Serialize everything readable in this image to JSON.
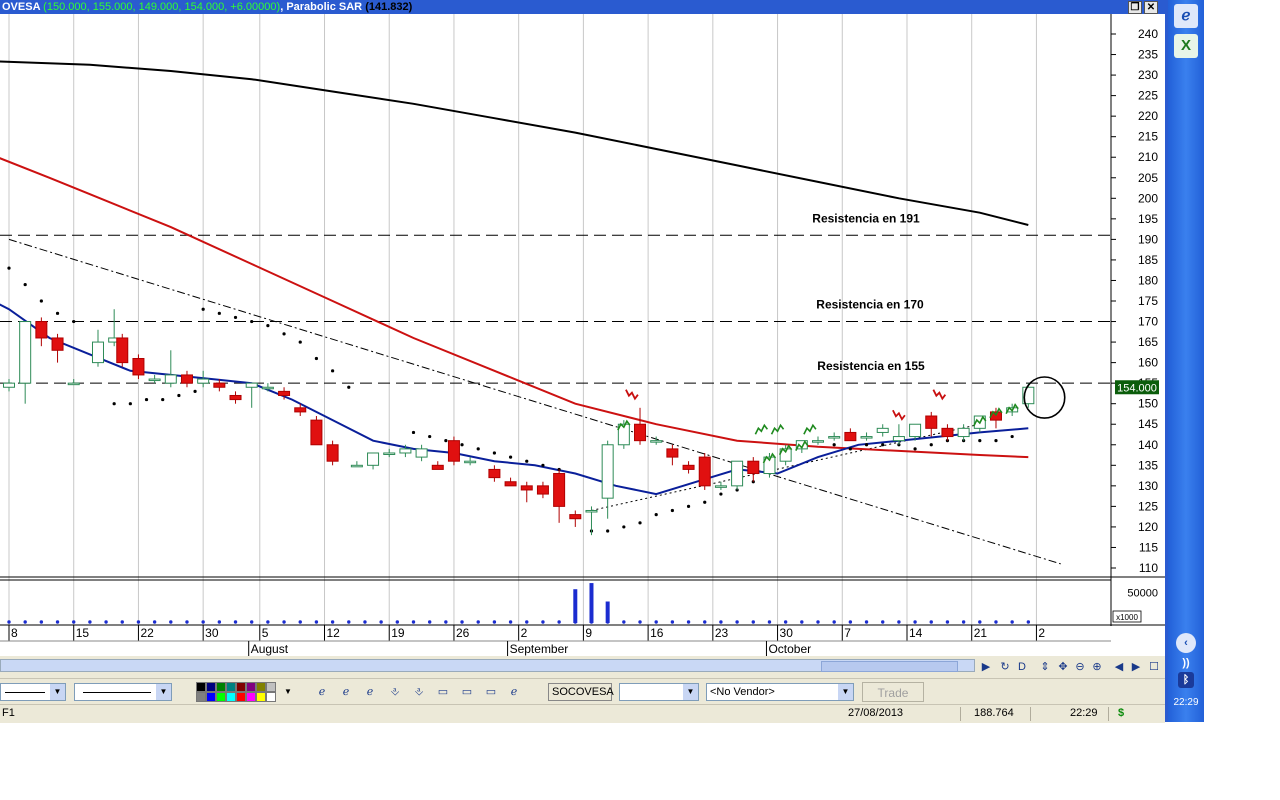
{
  "window": {
    "title_ticker": "OVESA",
    "title_values": "(150.000, 155.000, 149.000, 154.000, +6.00000)",
    "title_indicator": "Parabolic SAR",
    "title_sar_value": "(141.832)",
    "restore_label": "❐",
    "close_label": "✕"
  },
  "taskbar": {
    "clock": "22:29"
  },
  "toolbar": {
    "symbol": "SOCOVESA",
    "vendor": "<No Vendor>",
    "trade_label": "Trade",
    "palette": [
      "#000000",
      "#000080",
      "#008000",
      "#008080",
      "#800000",
      "#800080",
      "#808000",
      "#c0c0c0",
      "#808080",
      "#0000ff",
      "#00ff00",
      "#00ffff",
      "#ff0000",
      "#ff00ff",
      "#ffff00",
      "#ffffff"
    ],
    "nav_labels": [
      "D"
    ]
  },
  "statusbar": {
    "left": "F1",
    "date": "27/08/2013",
    "value": "188.764",
    "time": "22:29",
    "dollar": "$"
  },
  "chart_data": {
    "type": "candlestick",
    "ylim": [
      108,
      243
    ],
    "y_ticks": [
      110,
      115,
      120,
      125,
      130,
      135,
      140,
      145,
      150,
      155,
      160,
      165,
      170,
      175,
      180,
      185,
      190,
      195,
      200,
      205,
      210,
      215,
      220,
      225,
      230,
      235,
      240
    ],
    "x_tick_labels": [
      "8",
      "15",
      "22",
      "30",
      "5",
      "12",
      "19",
      "26",
      "2",
      "9",
      "16",
      "23",
      "30",
      "7",
      "14",
      "21",
      "2"
    ],
    "x_tick_index": [
      0,
      8,
      16,
      24,
      31,
      39,
      47,
      55,
      63,
      71,
      79,
      87,
      95,
      103,
      111,
      119,
      127
    ],
    "month_labels": [
      {
        "label": "August",
        "index": 30
      },
      {
        "label": "September",
        "index": 62
      },
      {
        "label": "October",
        "index": 94
      }
    ],
    "last_price_label": "154.000",
    "volume_axis_label": "50000",
    "volume_unit": "x1000",
    "annotations": [
      {
        "text": "Resistencia en 191",
        "value": 191
      },
      {
        "text": "Resistencia en 170",
        "value": 170
      },
      {
        "text": "Resistencia en 155",
        "value": 155
      }
    ],
    "candles": [
      {
        "i": 0,
        "o": 154,
        "h": 156,
        "l": 153,
        "c": 155
      },
      {
        "i": 2,
        "o": 155,
        "h": 170,
        "l": 150,
        "c": 170
      },
      {
        "i": 4,
        "o": 170,
        "h": 171,
        "l": 164,
        "c": 166
      },
      {
        "i": 6,
        "o": 166,
        "h": 167,
        "l": 160,
        "c": 163
      },
      {
        "i": 8,
        "o": 155,
        "h": 156,
        "l": 155,
        "c": 155
      },
      {
        "i": 11,
        "o": 160,
        "h": 168,
        "l": 159,
        "c": 165
      },
      {
        "i": 13,
        "o": 165,
        "h": 173,
        "l": 164,
        "c": 166
      },
      {
        "i": 14,
        "o": 166,
        "h": 167,
        "l": 159,
        "c": 160
      },
      {
        "i": 16,
        "o": 161,
        "h": 162,
        "l": 156,
        "c": 157
      },
      {
        "i": 18,
        "o": 156,
        "h": 157,
        "l": 155,
        "c": 156
      },
      {
        "i": 20,
        "o": 155,
        "h": 163,
        "l": 154,
        "c": 157
      },
      {
        "i": 22,
        "o": 157,
        "h": 158,
        "l": 154,
        "c": 155
      },
      {
        "i": 24,
        "o": 155,
        "h": 158,
        "l": 154,
        "c": 156
      },
      {
        "i": 26,
        "o": 155,
        "h": 156,
        "l": 153,
        "c": 154
      },
      {
        "i": 28,
        "o": 152,
        "h": 153,
        "l": 150,
        "c": 151
      },
      {
        "i": 30,
        "o": 154,
        "h": 155,
        "l": 149,
        "c": 155
      },
      {
        "i": 32,
        "o": 154,
        "h": 155,
        "l": 153,
        "c": 154
      },
      {
        "i": 34,
        "o": 153,
        "h": 154,
        "l": 151,
        "c": 152
      },
      {
        "i": 36,
        "o": 149,
        "h": 150,
        "l": 147,
        "c": 148
      },
      {
        "i": 38,
        "o": 146,
        "h": 147,
        "l": 140,
        "c": 140
      },
      {
        "i": 40,
        "o": 140,
        "h": 141,
        "l": 135,
        "c": 136
      },
      {
        "i": 43,
        "o": 135,
        "h": 136,
        "l": 135,
        "c": 135
      },
      {
        "i": 45,
        "o": 135,
        "h": 138,
        "l": 134,
        "c": 138
      },
      {
        "i": 47,
        "o": 138,
        "h": 139,
        "l": 137,
        "c": 138
      },
      {
        "i": 49,
        "o": 138,
        "h": 140,
        "l": 137,
        "c": 139
      },
      {
        "i": 51,
        "o": 137,
        "h": 140,
        "l": 136,
        "c": 139
      },
      {
        "i": 53,
        "o": 135,
        "h": 136,
        "l": 134,
        "c": 134
      },
      {
        "i": 55,
        "o": 141,
        "h": 142,
        "l": 135,
        "c": 136
      },
      {
        "i": 57,
        "o": 136,
        "h": 137,
        "l": 135,
        "c": 136
      },
      {
        "i": 60,
        "o": 134,
        "h": 135,
        "l": 131,
        "c": 132
      },
      {
        "i": 62,
        "o": 131,
        "h": 132,
        "l": 130,
        "c": 130
      },
      {
        "i": 64,
        "o": 130,
        "h": 131,
        "l": 126,
        "c": 129
      },
      {
        "i": 66,
        "o": 130,
        "h": 131,
        "l": 127,
        "c": 128
      },
      {
        "i": 68,
        "o": 133,
        "h": 134,
        "l": 121,
        "c": 125
      },
      {
        "i": 70,
        "o": 123,
        "h": 124,
        "l": 120,
        "c": 122
      },
      {
        "i": 72,
        "o": 124,
        "h": 125,
        "l": 118,
        "c": 124
      },
      {
        "i": 74,
        "o": 127,
        "h": 141,
        "l": 122,
        "c": 140
      },
      {
        "i": 76,
        "o": 140,
        "h": 146,
        "l": 139,
        "c": 145
      },
      {
        "i": 78,
        "o": 145,
        "h": 149,
        "l": 140,
        "c": 141
      },
      {
        "i": 80,
        "o": 141,
        "h": 142,
        "l": 140,
        "c": 141
      },
      {
        "i": 82,
        "o": 139,
        "h": 140,
        "l": 135,
        "c": 137
      },
      {
        "i": 84,
        "o": 135,
        "h": 136,
        "l": 133,
        "c": 134
      },
      {
        "i": 86,
        "o": 137,
        "h": 138,
        "l": 129,
        "c": 130
      },
      {
        "i": 88,
        "o": 130,
        "h": 131,
        "l": 129,
        "c": 130
      },
      {
        "i": 90,
        "o": 130,
        "h": 136,
        "l": 129,
        "c": 136
      },
      {
        "i": 92,
        "o": 136,
        "h": 137,
        "l": 131,
        "c": 133
      },
      {
        "i": 94,
        "o": 133,
        "h": 138,
        "l": 132,
        "c": 137
      },
      {
        "i": 96,
        "o": 136,
        "h": 140,
        "l": 135,
        "c": 139
      },
      {
        "i": 98,
        "o": 139,
        "h": 141,
        "l": 138,
        "c": 141
      },
      {
        "i": 100,
        "o": 141,
        "h": 142,
        "l": 140,
        "c": 141
      },
      {
        "i": 102,
        "o": 142,
        "h": 143,
        "l": 141,
        "c": 142
      },
      {
        "i": 104,
        "o": 143,
        "h": 144,
        "l": 141,
        "c": 141
      },
      {
        "i": 106,
        "o": 142,
        "h": 143,
        "l": 141,
        "c": 142
      },
      {
        "i": 108,
        "o": 143,
        "h": 145,
        "l": 142,
        "c": 144
      },
      {
        "i": 110,
        "o": 141,
        "h": 145,
        "l": 140,
        "c": 142
      },
      {
        "i": 112,
        "o": 142,
        "h": 145,
        "l": 141,
        "c": 145
      },
      {
        "i": 114,
        "o": 147,
        "h": 148,
        "l": 142,
        "c": 144
      },
      {
        "i": 116,
        "o": 144,
        "h": 145,
        "l": 141,
        "c": 142
      },
      {
        "i": 118,
        "o": 142,
        "h": 145,
        "l": 141,
        "c": 144
      },
      {
        "i": 120,
        "o": 144,
        "h": 147,
        "l": 143,
        "c": 147
      },
      {
        "i": 122,
        "o": 148,
        "h": 149,
        "l": 144,
        "c": 146
      },
      {
        "i": 124,
        "o": 148,
        "h": 150,
        "l": 147,
        "c": 149
      },
      {
        "i": 126,
        "o": 150,
        "h": 155,
        "l": 149,
        "c": 154
      }
    ],
    "series": [
      {
        "role": "sma-long",
        "color": "#000000",
        "x": [
          -4,
          10,
          20,
          30,
          40,
          50,
          60,
          70,
          80,
          90,
          100,
          110,
          120,
          126
        ],
        "y": [
          233.5,
          232.5,
          231,
          229,
          226,
          223,
          219.5,
          216,
          212,
          208,
          204,
          200,
          196.5,
          193.5
        ]
      },
      {
        "role": "sma-medium",
        "color": "#cc1111",
        "x": [
          -4,
          5,
          10,
          20,
          30,
          40,
          50,
          60,
          70,
          80,
          90,
          100,
          110,
          120,
          126
        ],
        "y": [
          212,
          205,
          201,
          193,
          184,
          175,
          166,
          158,
          150,
          145,
          141,
          139.5,
          138.5,
          137.5,
          137
        ]
      },
      {
        "role": "ema-short",
        "color": "#0a1f9a",
        "x": [
          -4,
          0,
          5,
          10,
          15,
          20,
          25,
          30,
          35,
          40,
          45,
          50,
          55,
          60,
          65,
          70,
          75,
          80,
          85,
          90,
          95,
          100,
          105,
          110,
          115,
          120,
          126
        ],
        "y": [
          177,
          173,
          166,
          162,
          158,
          157,
          156,
          155,
          151,
          146,
          141,
          139,
          138,
          136,
          135,
          133,
          130,
          128,
          131,
          134,
          133,
          137,
          140,
          141,
          142,
          143,
          144
        ]
      }
    ],
    "sar": [
      {
        "i": 0,
        "y": 183
      },
      {
        "i": 2,
        "y": 179
      },
      {
        "i": 4,
        "y": 175
      },
      {
        "i": 6,
        "y": 172
      },
      {
        "i": 8,
        "y": 170
      },
      {
        "i": 13,
        "y": 150
      },
      {
        "i": 15,
        "y": 150
      },
      {
        "i": 17,
        "y": 151
      },
      {
        "i": 19,
        "y": 151
      },
      {
        "i": 21,
        "y": 152
      },
      {
        "i": 23,
        "y": 153
      },
      {
        "i": 24,
        "y": 173
      },
      {
        "i": 26,
        "y": 172
      },
      {
        "i": 28,
        "y": 171
      },
      {
        "i": 30,
        "y": 170
      },
      {
        "i": 32,
        "y": 169
      },
      {
        "i": 34,
        "y": 167
      },
      {
        "i": 36,
        "y": 165
      },
      {
        "i": 38,
        "y": 161
      },
      {
        "i": 40,
        "y": 158
      },
      {
        "i": 42,
        "y": 154
      },
      {
        "i": 50,
        "y": 143
      },
      {
        "i": 52,
        "y": 142
      },
      {
        "i": 54,
        "y": 141
      },
      {
        "i": 56,
        "y": 140
      },
      {
        "i": 58,
        "y": 139
      },
      {
        "i": 60,
        "y": 138
      },
      {
        "i": 62,
        "y": 137
      },
      {
        "i": 64,
        "y": 136
      },
      {
        "i": 66,
        "y": 135
      },
      {
        "i": 68,
        "y": 134
      },
      {
        "i": 72,
        "y": 119
      },
      {
        "i": 74,
        "y": 119
      },
      {
        "i": 76,
        "y": 120
      },
      {
        "i": 78,
        "y": 121
      },
      {
        "i": 80,
        "y": 123
      },
      {
        "i": 82,
        "y": 124
      },
      {
        "i": 84,
        "y": 125
      },
      {
        "i": 86,
        "y": 126
      },
      {
        "i": 88,
        "y": 128
      },
      {
        "i": 90,
        "y": 129
      },
      {
        "i": 92,
        "y": 131
      },
      {
        "i": 102,
        "y": 140
      },
      {
        "i": 104,
        "y": 139
      },
      {
        "i": 106,
        "y": 140
      },
      {
        "i": 108,
        "y": 140
      },
      {
        "i": 110,
        "y": 140
      },
      {
        "i": 112,
        "y": 139
      },
      {
        "i": 114,
        "y": 140
      },
      {
        "i": 116,
        "y": 141
      },
      {
        "i": 118,
        "y": 141
      },
      {
        "i": 120,
        "y": 141
      },
      {
        "i": 122,
        "y": 141
      },
      {
        "i": 124,
        "y": 142
      }
    ],
    "trendlines": [
      {
        "style": "dash-dot",
        "x": [
          0,
          130
        ],
        "y": [
          190,
          111
        ]
      },
      {
        "style": "dotted",
        "x": [
          72,
          120
        ],
        "y": [
          124,
          145
        ]
      }
    ],
    "bull_markers": [
      76,
      93,
      94,
      95,
      96,
      98,
      99,
      120,
      122,
      124
    ],
    "bear_markers": [
      77,
      110,
      115
    ],
    "ellipse": {
      "cx": 128,
      "cy": 151.5,
      "rx": 2.5,
      "ry": 5
    },
    "volume": {
      "dot_step": 2,
      "bars": [
        {
          "i": 70,
          "v": 55000
        },
        {
          "i": 72,
          "v": 65000
        },
        {
          "i": 74,
          "v": 35000
        }
      ],
      "ylim": [
        0,
        70000
      ]
    }
  }
}
